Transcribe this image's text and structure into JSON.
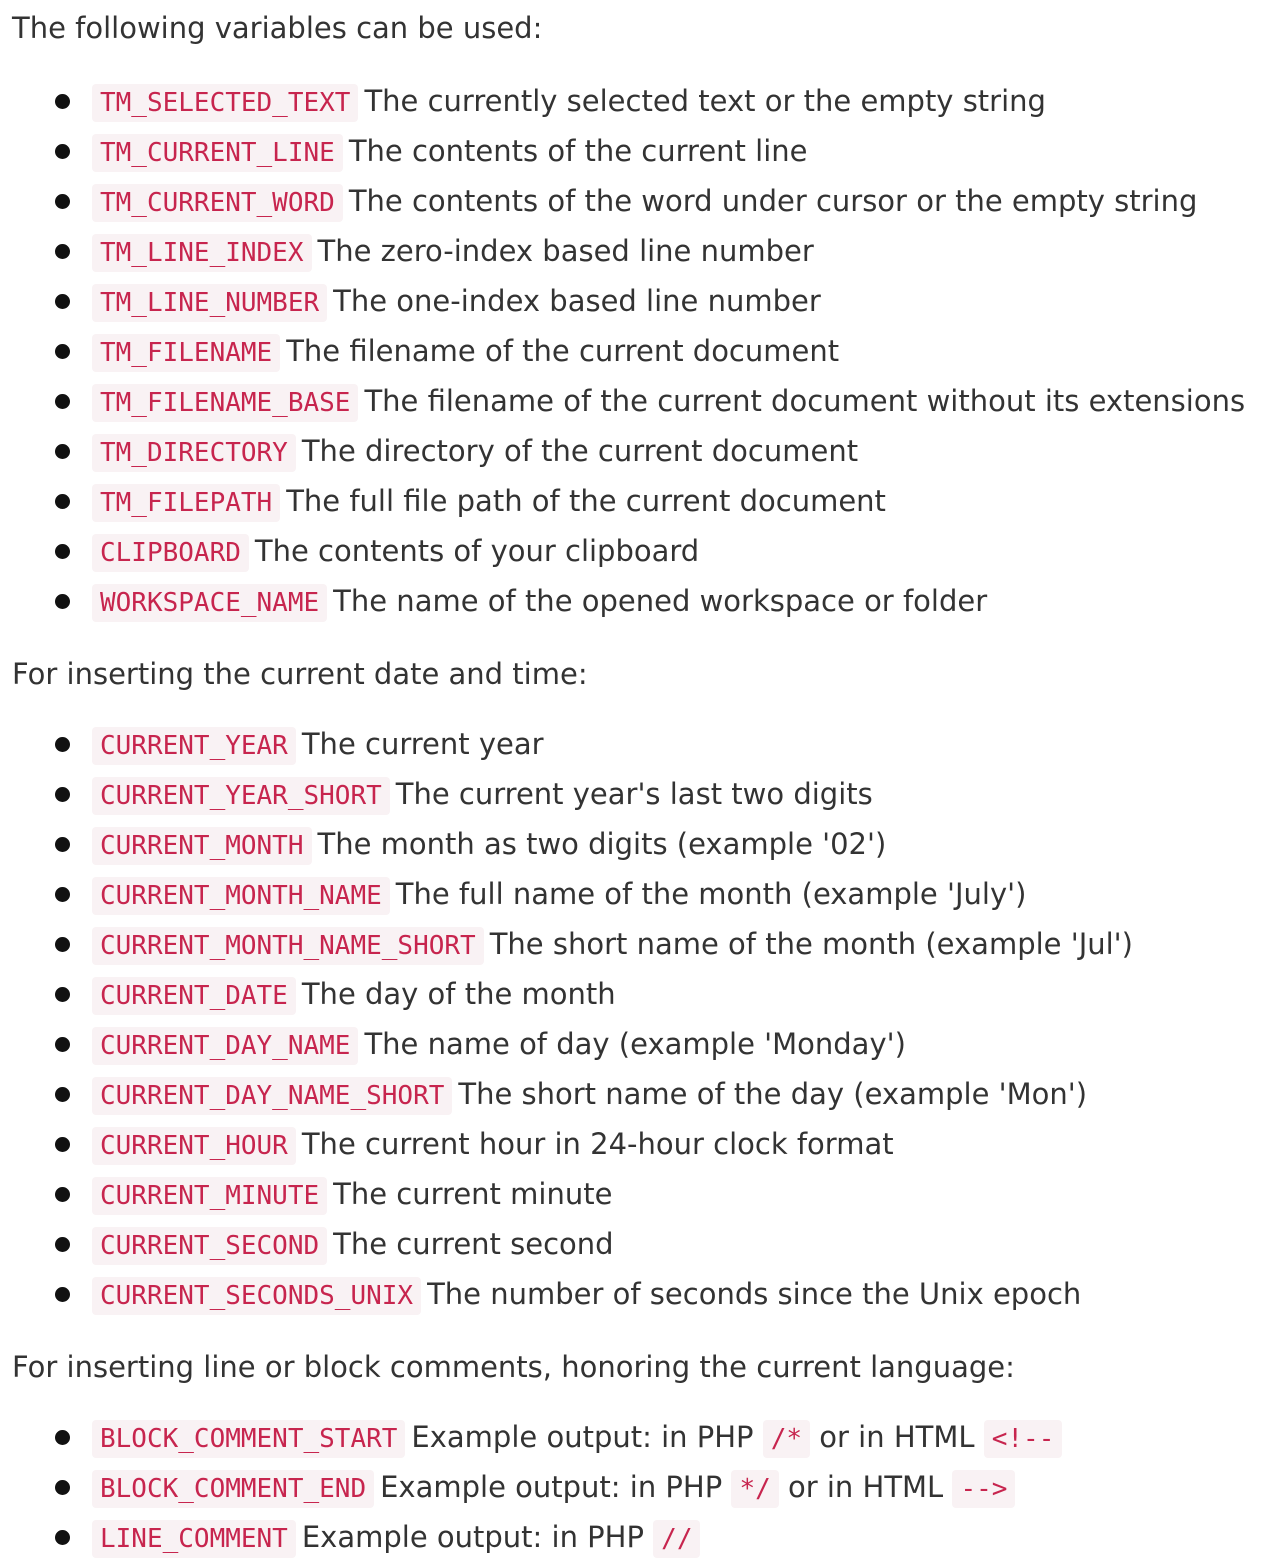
{
  "sections": [
    {
      "heading": "The following variables can be used:",
      "items": [
        {
          "code": "TM_SELECTED_TEXT",
          "desc": "The currently selected text or the empty string"
        },
        {
          "code": "TM_CURRENT_LINE",
          "desc": "The contents of the current line"
        },
        {
          "code": "TM_CURRENT_WORD",
          "desc": "The contents of the word under cursor or the empty string"
        },
        {
          "code": "TM_LINE_INDEX",
          "desc": "The zero-index based line number"
        },
        {
          "code": "TM_LINE_NUMBER",
          "desc": "The one-index based line number"
        },
        {
          "code": "TM_FILENAME",
          "desc": "The filename of the current document"
        },
        {
          "code": "TM_FILENAME_BASE",
          "desc": "The filename of the current document without its extensions"
        },
        {
          "code": "TM_DIRECTORY",
          "desc": "The directory of the current document"
        },
        {
          "code": "TM_FILEPATH",
          "desc": "The full file path of the current document"
        },
        {
          "code": "CLIPBOARD",
          "desc": "The contents of your clipboard"
        },
        {
          "code": "WORKSPACE_NAME",
          "desc": "The name of the opened workspace or folder"
        }
      ]
    },
    {
      "heading": "For inserting the current date and time:",
      "items": [
        {
          "code": "CURRENT_YEAR",
          "desc": "The current year"
        },
        {
          "code": "CURRENT_YEAR_SHORT",
          "desc": "The current year's last two digits"
        },
        {
          "code": "CURRENT_MONTH",
          "desc": "The month as two digits (example '02')"
        },
        {
          "code": "CURRENT_MONTH_NAME",
          "desc": "The full name of the month (example 'July')"
        },
        {
          "code": "CURRENT_MONTH_NAME_SHORT",
          "desc": "The short name of the month (example 'Jul')"
        },
        {
          "code": "CURRENT_DATE",
          "desc": "The day of the month"
        },
        {
          "code": "CURRENT_DAY_NAME",
          "desc": "The name of day (example 'Monday')"
        },
        {
          "code": "CURRENT_DAY_NAME_SHORT",
          "desc": "The short name of the day (example 'Mon')"
        },
        {
          "code": "CURRENT_HOUR",
          "desc": "The current hour in 24-hour clock format"
        },
        {
          "code": "CURRENT_MINUTE",
          "desc": "The current minute"
        },
        {
          "code": "CURRENT_SECOND",
          "desc": "The current second"
        },
        {
          "code": "CURRENT_SECONDS_UNIX",
          "desc": "The number of seconds since the Unix epoch"
        }
      ]
    },
    {
      "heading": "For inserting line or block comments, honoring the current language:",
      "items": [
        {
          "code": "BLOCK_COMMENT_START",
          "desc": "Example output: in PHP",
          "php_code": "/*",
          "mid": "or in HTML",
          "html_code": "<!--"
        },
        {
          "code": "BLOCK_COMMENT_END",
          "desc": "Example output: in PHP",
          "php_code": "*/",
          "mid": "or in HTML",
          "html_code": "-->"
        },
        {
          "code": "LINE_COMMENT",
          "desc": "Example output: in PHP",
          "php_code": "//"
        }
      ]
    }
  ],
  "colors": {
    "text": "#333333",
    "code_text": "#c7254e",
    "code_bg": "#f9f2f4",
    "bullet": "#111111"
  }
}
